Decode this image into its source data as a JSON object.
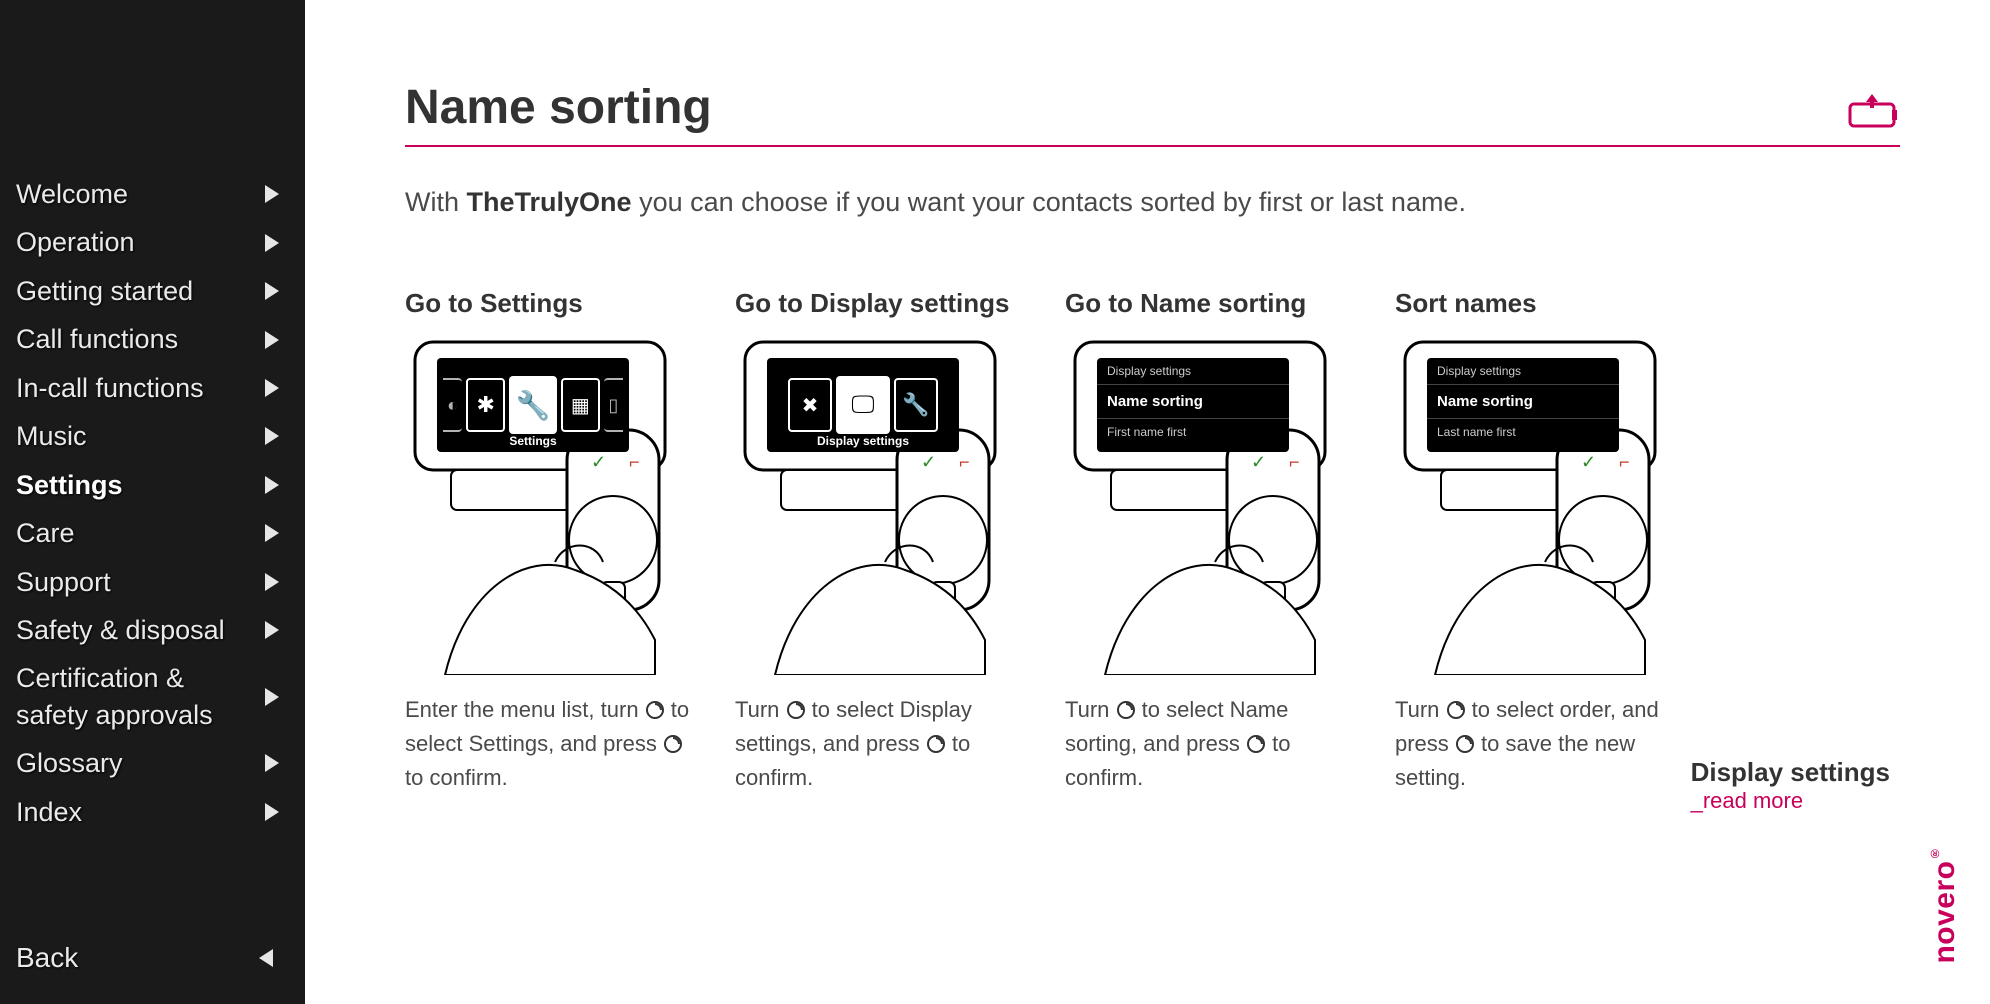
{
  "sidebar": {
    "items": [
      {
        "label": "Welcome",
        "active": false
      },
      {
        "label": "Operation",
        "active": false
      },
      {
        "label": "Getting started",
        "active": false
      },
      {
        "label": "Call functions",
        "active": false
      },
      {
        "label": "In-call functions",
        "active": false
      },
      {
        "label": "Music",
        "active": false
      },
      {
        "label": "Settings",
        "active": true
      },
      {
        "label": "Care",
        "active": false
      },
      {
        "label": "Support",
        "active": false
      },
      {
        "label": "Safety & disposal",
        "active": false
      },
      {
        "label": "Certification & safety approvals",
        "active": false
      },
      {
        "label": "Glossary",
        "active": false
      },
      {
        "label": "Index",
        "active": false
      }
    ],
    "back_label": "Back"
  },
  "page": {
    "title": "Name sorting",
    "intro_prefix": "With ",
    "intro_product": "TheTrulyOne",
    "intro_suffix": " you can choose if you want your contacts sorted by first or last name."
  },
  "steps": [
    {
      "title": "Go to Settings",
      "screen_label": "Settings",
      "caption_parts": [
        "Enter the menu list, turn ",
        " to select Settings, and press ",
        " to confirm."
      ]
    },
    {
      "title": "Go to Display settings",
      "screen_label": "Display settings",
      "caption_parts": [
        "Turn ",
        " to select Display settings, and press ",
        " to confirm."
      ]
    },
    {
      "title": "Go to Name sorting",
      "screen_lines": [
        "Display settings",
        "Name sorting",
        "First name first"
      ],
      "caption_parts": [
        "Turn ",
        " to select Name sorting, and press ",
        " to confirm."
      ]
    },
    {
      "title": "Sort names",
      "screen_lines": [
        "Display settings",
        "Name sorting",
        "Last name first"
      ],
      "caption_parts": [
        "Turn ",
        " to select order, and press ",
        " to save the new setting."
      ]
    }
  ],
  "readmore": {
    "title": "Display settings",
    "link": "_read more"
  },
  "brand": "novero",
  "colors": {
    "accent": "#c9005b",
    "sidebar_bg": "#1a1a1a"
  }
}
